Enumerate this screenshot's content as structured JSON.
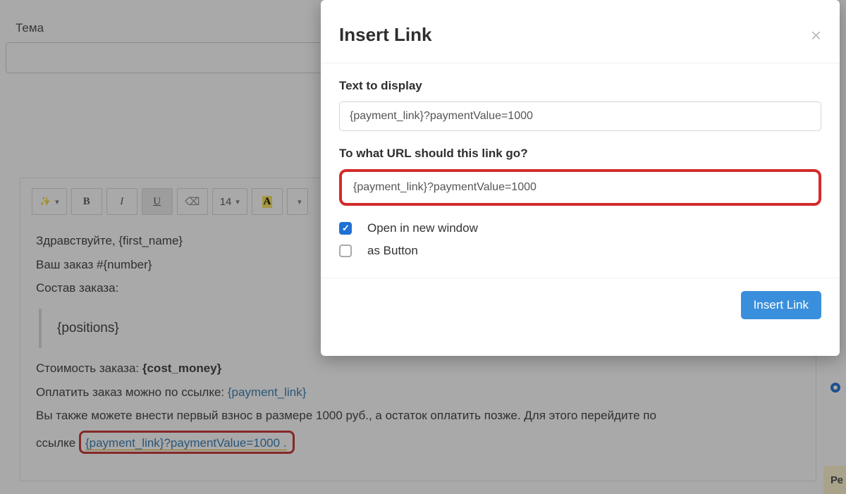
{
  "form": {
    "theme_label": "Тема",
    "theme_value": ""
  },
  "toolbar": {
    "bold": "B",
    "italic": "I",
    "underline": "U",
    "fontsize": "14",
    "font_a": "A"
  },
  "content": {
    "greeting": "Здравствуйте, {first_name}",
    "order_no": "Ваш заказ #{number}",
    "order_items_label": "Состав заказа:",
    "positions": "{positions}",
    "cost_prefix": "Стоимость заказа: ",
    "cost_var": "{cost_money}",
    "pay_prefix": "Оплатить заказ можно по ссылке: ",
    "pay_var": "{payment_link}",
    "deposit_line1": "Вы также можете внести первый взнос в размере 1000 руб., а остаток оплатить позже. Для этого перейдите по",
    "deposit_line2_prefix": "ссылке ",
    "deposit_link": "{payment_link}?paymentValue=1000 ."
  },
  "modal": {
    "title": "Insert Link",
    "text_label": "Text to display",
    "text_value": "{payment_link}?paymentValue=1000",
    "url_label": "To what URL should this link go?",
    "url_value": "{payment_link}?paymentValue=1000",
    "open_new": "Open in new window",
    "as_button": "as Button",
    "submit": "Insert Link"
  },
  "sidebar": {
    "chip": "Ре"
  }
}
